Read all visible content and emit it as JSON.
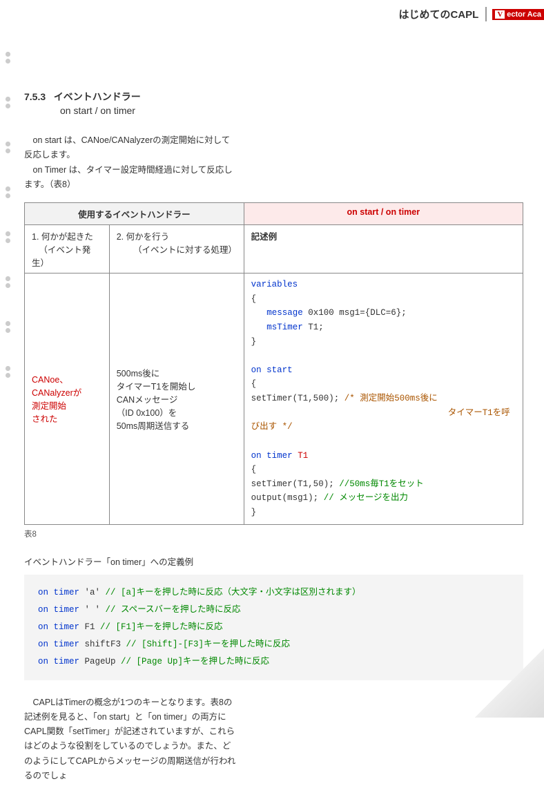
{
  "header": {
    "breadcrumb": "はじめてのCAPL",
    "logo_text": "ector Aca"
  },
  "section": {
    "number": "7.5.3",
    "title": "イベントハンドラー",
    "subtitle": "on start / on timer"
  },
  "intro": {
    "p1": "on start は、CANoe/CANalyzerの測定開始に対して反応します。",
    "p2": "on Timer は、タイマー設定時間経過に対して反応します。（表8）"
  },
  "table": {
    "header_left": "使用するイベントハンドラー",
    "header_right": "on start  /  on timer",
    "sub1_label": "1. 何かが起きた",
    "sub1_detail": "（イベント発生）",
    "sub2_label": "2. 何かを行う",
    "sub2_detail": "（イベントに対する処理）",
    "sub3": "記述例",
    "row": {
      "col1_l1": "CANoe、",
      "col1_l2": "CANalyzerが",
      "col1_l3": "測定開始",
      "col1_l4": "された",
      "col2_l1": "500ms後に",
      "col2_l2": "タイマーT1を開始し",
      "col2_l3": "CANメッセージ",
      "col2_l4": "（ID 0x100）を",
      "col2_l5": "50ms周期送信する"
    },
    "code": {
      "variables": "variables",
      "msg_decl": " 0x100 msg1={DLC=6};",
      "msg_kw": "message",
      "timer_kw": "msTimer",
      "timer_name": " T1;",
      "onstart": "on start",
      "setTimer500": "   setTimer(T1,500);   ",
      "cmt500a": "/* 測定開始500ms後に",
      "cmt500b": "タイマーT1を呼び出す */",
      "ontimer": "on timer ",
      "ontimer_t1": "T1",
      "setTimer50": "   setTimer(T1,50);  ",
      "cmt50": "//50ms毎T1をセット",
      "output": "   output(msg1);   ",
      "cmtOut": "// メッセージを出力"
    }
  },
  "caption": "表8",
  "defex_title": "イベントハンドラー「on timer」への定義例",
  "examples": {
    "kw": "on timer",
    "l1_arg": " 'a'   ",
    "l1_cmt": "// [a]キーを押した時に反応（大文字・小文字は区別されます）",
    "l2_arg": " ' '   ",
    "l2_cmt": "// スペースバーを押した時に反応",
    "l3_arg": " F1   ",
    "l3_cmt": "// [F1]キーを押した時に反応",
    "l4_arg": " shiftF3   ",
    "l4_cmt": "// [Shift]-[F3]キーを押した時に反応",
    "l5_arg": " PageUp   ",
    "l5_cmt": "// [Page Up]キーを押した時に反応"
  },
  "outro": {
    "p1": "CAPLはTimerの概念が1つのキーとなります。表8の記述例を見ると、「on start」と「on timer」の両方にCAPL関数「setTimer」が記述されていますが、これらはどのような役割をしているのでしょうか。また、どのようにしてCAPLからメッセージの周期送信が行われるのでしょ"
  }
}
